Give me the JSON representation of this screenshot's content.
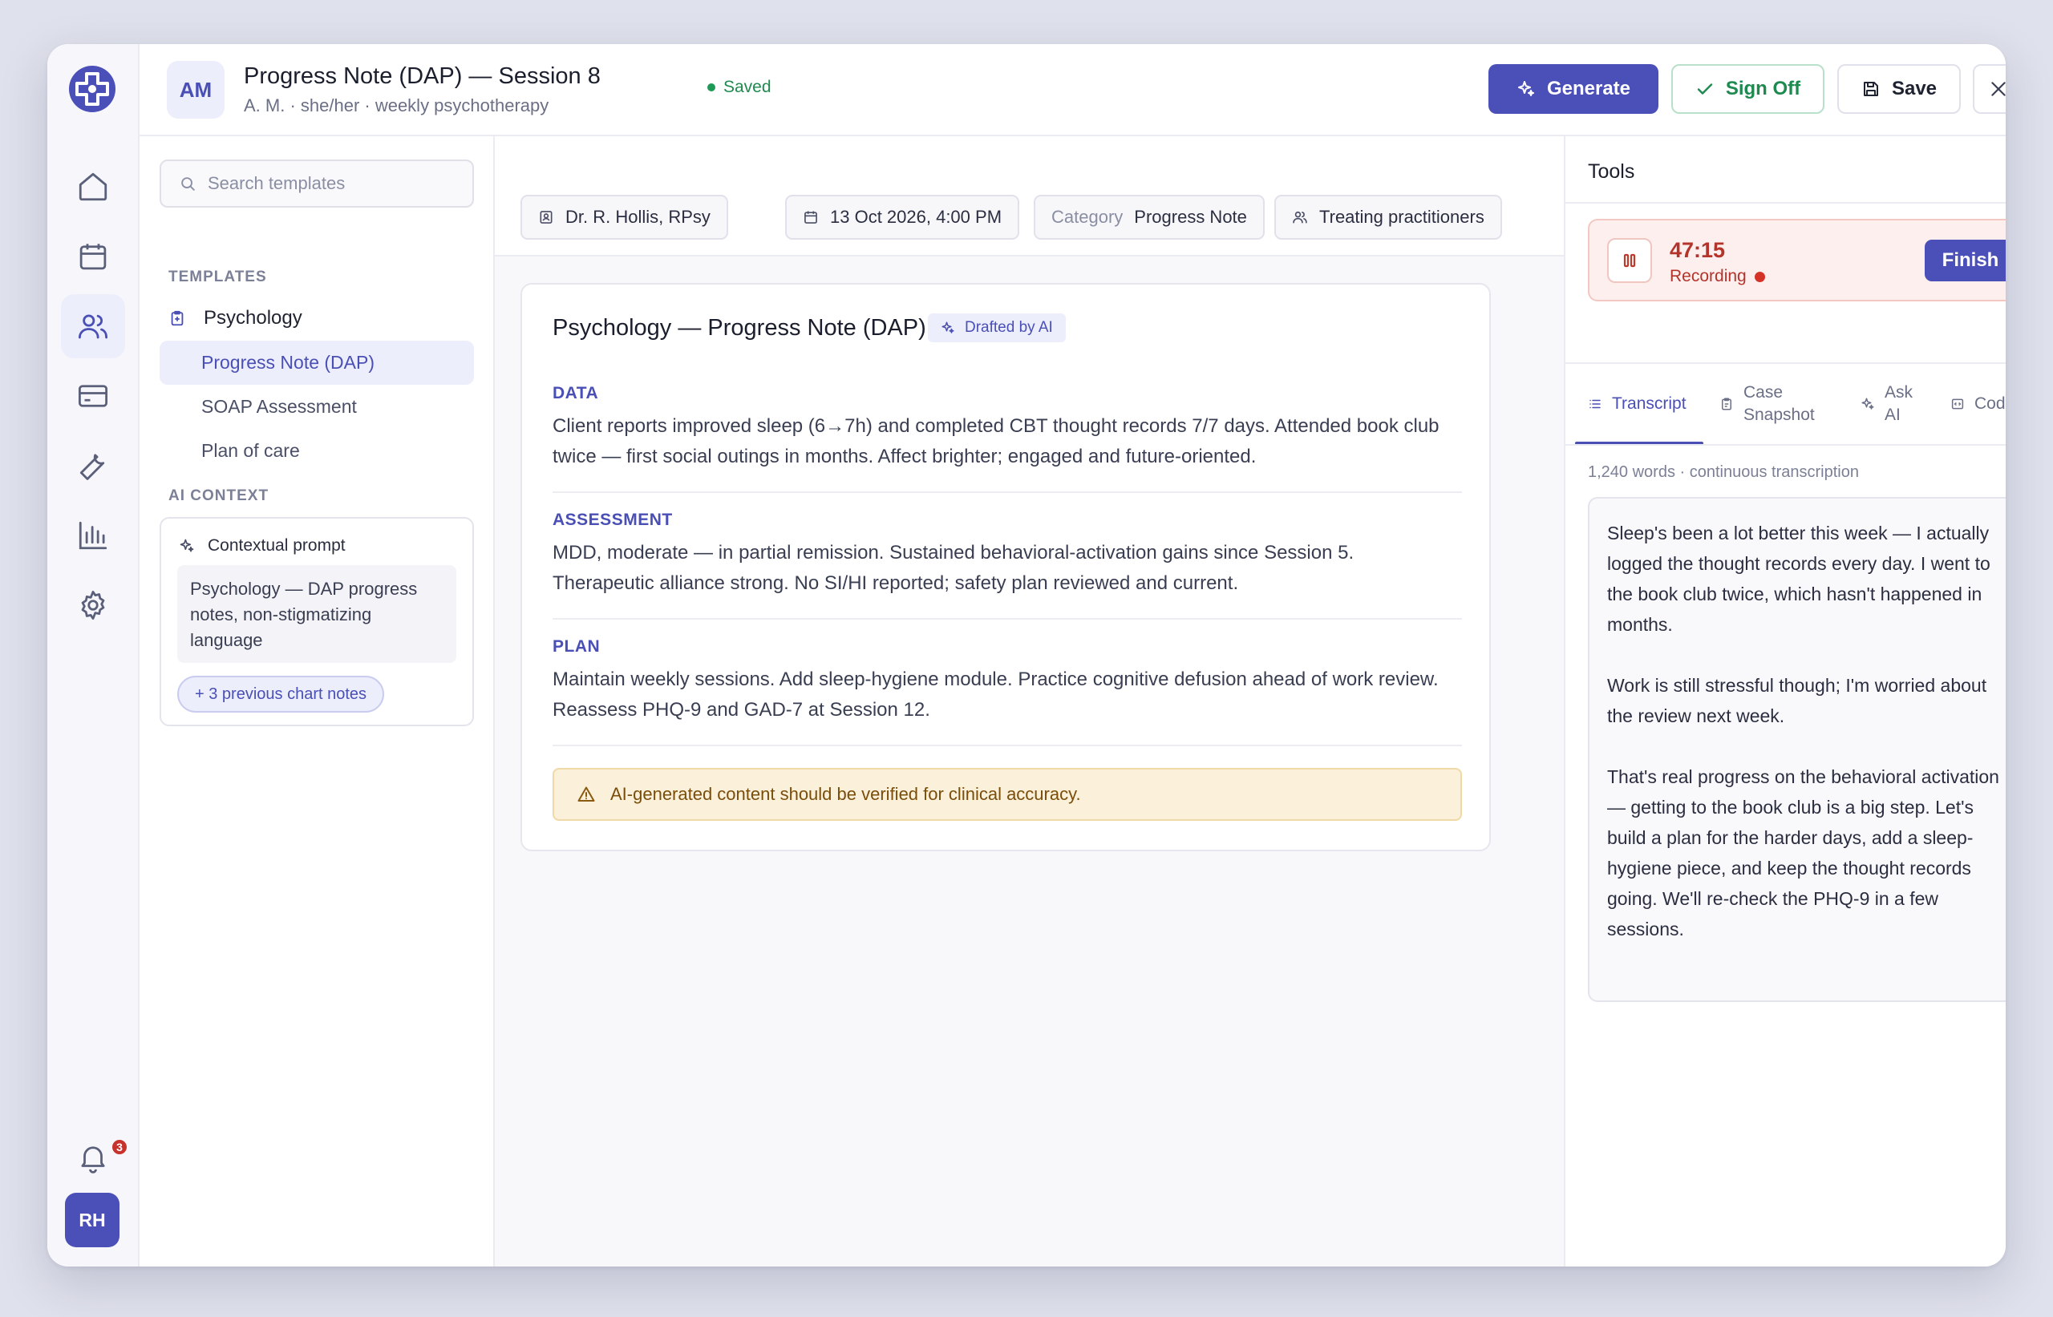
{
  "app": {
    "rail_items": [
      {
        "name": "home",
        "icon": "home-icon"
      },
      {
        "name": "calendar",
        "icon": "calendar-icon"
      },
      {
        "name": "patients",
        "icon": "users-icon",
        "active": true
      },
      {
        "name": "billing",
        "icon": "credit-card-icon"
      },
      {
        "name": "tools",
        "icon": "wrench-icon"
      },
      {
        "name": "reports",
        "icon": "bar-chart-icon"
      },
      {
        "name": "settings",
        "icon": "gear-icon"
      }
    ],
    "notifications_count": "3",
    "user_initials": "RH",
    "colors": {
      "accent": "#4b4fb8",
      "success": "#1e8a4f",
      "danger": "#b4332a",
      "warning_bg": "#fbf0d9"
    }
  },
  "header": {
    "patient_initials": "AM",
    "title": "Progress Note (DAP) — Session 8",
    "subtitle": "A. M. · she/her · weekly psychotherapy",
    "status": "Saved",
    "generate_label": "Generate",
    "signoff_label": "Sign Off",
    "save_label": "Save"
  },
  "sidebar": {
    "search_placeholder": "Search templates",
    "templates_label": "TEMPLATES",
    "folder": "Psychology",
    "items": [
      {
        "label": "Progress Note (DAP)",
        "active": true
      },
      {
        "label": "SOAP Assessment",
        "active": false
      },
      {
        "label": "Plan of care",
        "active": false
      }
    ],
    "ai_context_label": "AI CONTEXT",
    "context_prompt_label": "Contextual prompt",
    "context_prompt_text": "Psychology — DAP progress notes, non-stigmatizing language",
    "previous_notes_chip": "+ 3 previous chart notes"
  },
  "meta": {
    "practitioner": "Dr. R. Hollis, RPsy",
    "datetime": "13 Oct 2026, 4:00 PM",
    "category_label": "Category",
    "category_value": "Progress Note",
    "treating": "Treating practitioners"
  },
  "note": {
    "title": "Psychology — Progress Note (DAP)",
    "ai_tag": "Drafted by AI",
    "sections": [
      {
        "label": "DATA",
        "text": "Client reports improved sleep (6→7h) and completed CBT thought records 7/7 days. Attended book club twice — first social outings in months. Affect brighter; engaged and future-oriented."
      },
      {
        "label": "ASSESSMENT",
        "text": "MDD, moderate — in partial remission. Sustained behavioral-activation gains since Session 5. Therapeutic alliance strong. No SI/HI reported; safety plan reviewed and current."
      },
      {
        "label": "PLAN",
        "text": "Maintain weekly sessions. Add sleep-hygiene module. Practice cognitive defusion ahead of work review. Reassess PHQ-9 and GAD-7 at Session 12."
      }
    ],
    "warning": "AI-generated content should be verified for clinical accuracy."
  },
  "tools": {
    "title": "Tools",
    "timer": "47:15",
    "recording_status": "Recording",
    "finish_label": "Finish",
    "tabs": [
      {
        "label": "Transcript",
        "icon": "list-icon",
        "active": true
      },
      {
        "label": "Case Snapshot",
        "icon": "clipboard-icon",
        "active": false
      },
      {
        "label": "Ask AI",
        "icon": "sparkle-icon",
        "active": false
      },
      {
        "label": "Coding",
        "icon": "code-icon",
        "active": false
      }
    ],
    "word_count": "1,240 words · continuous transcription",
    "transcript": [
      "Sleep's been a lot better this week — I actually logged the thought records every day. I went to the book club twice, which hasn't happened in months.",
      "Work is still stressful though; I'm worried about the review next week.",
      "That's real progress on the behavioral activation — getting to the book club is a big step. Let's build a plan for the harder days, add a sleep-hygiene piece, and keep the thought records going. We'll re-check the PHQ-9 in a few sessions."
    ]
  }
}
